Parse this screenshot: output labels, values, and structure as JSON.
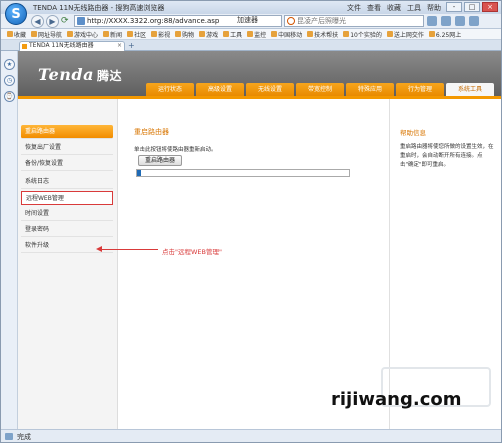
{
  "window": {
    "title": "TENDA 11N无线路由器 - 搜狗高速浏览器",
    "menus": [
      "文件",
      "查看",
      "收藏",
      "工具",
      "帮助"
    ],
    "controls": [
      "-",
      "□",
      "×"
    ]
  },
  "nav": {
    "address": "http://XXXX.3322.org:88/advance.asp",
    "accelerator": "加速器",
    "search_placeholder": "昆凌产后照曝光"
  },
  "bookmarks": [
    "收藏",
    "网址导航",
    "游戏中心",
    "新闻",
    "社区",
    "影视",
    "购物",
    "游戏",
    "工具",
    "监控",
    "中国移动",
    "技术帮扶",
    "10个实验的",
    "送上网交作",
    "6.25网上"
  ],
  "tab": {
    "label": "TENDA 11N无线路由器",
    "close": "×",
    "new": "+"
  },
  "router": {
    "brand": "Tenda",
    "brand_cn": "腾达",
    "menu": [
      "运行状态",
      "高级设置",
      "无线设置",
      "带宽控制",
      "特殊应用",
      "行为管理",
      "系统工具"
    ],
    "active_menu": "系统工具",
    "left_nav": [
      "重启路由器",
      "恢复出厂设置",
      "备份/恢复设置",
      "系统日志",
      "远程WEB管理",
      "时间设置",
      "登录密码",
      "软件升级"
    ],
    "content_title": "重启路由器",
    "content_desc": "单击此按钮将使路由器重新启动。",
    "reboot_button": "重启路由器",
    "progress": 0.02,
    "annotation": "点击\"远程WEB管理\"",
    "help_title": "帮助信息",
    "help_text": "重启路由器将使您所做的设置生效，在重启时，会自动断开所有连接。点击\"确定\"即可重启。"
  },
  "watermark": "rijiwang.com",
  "status": "完成",
  "colors": {
    "accent": "#f39800",
    "highlight": "#d93a3a",
    "progress": "#1f6ab5"
  }
}
